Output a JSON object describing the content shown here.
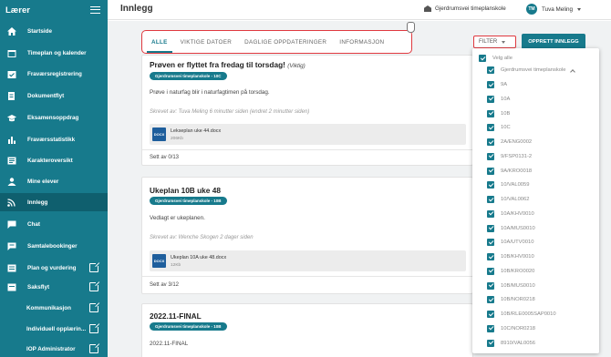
{
  "sidebar": {
    "title": "Lærer",
    "items": [
      {
        "label": "Startside",
        "icon": "home-icon"
      },
      {
        "label": "Timeplan og kalender",
        "icon": "calendar-icon"
      },
      {
        "label": "Fraværsregistrering",
        "icon": "calendar-check-icon"
      },
      {
        "label": "Dokumentflyt",
        "icon": "document-icon"
      },
      {
        "label": "Eksamensoppdrag",
        "icon": "graduation-cap-icon"
      },
      {
        "label": "Fraværsstatistikk",
        "icon": "bar-chart-icon"
      },
      {
        "label": "Karakteroversikt",
        "icon": "grades-icon"
      },
      {
        "label": "Mine elever",
        "icon": "students-icon"
      },
      {
        "label": "Innlegg",
        "icon": "rss-icon"
      },
      {
        "label": "Chat",
        "icon": "chat-icon"
      },
      {
        "label": "Samtalebookinger",
        "icon": "booking-icon"
      },
      {
        "label": "Plan og vurdering",
        "icon": "plan-icon"
      },
      {
        "label": "Saksflyt",
        "icon": "case-icon"
      },
      {
        "label": "Kommunikasjon",
        "icon": ""
      },
      {
        "label": "Individuell opplærin...",
        "icon": ""
      },
      {
        "label": "IOP Administrator",
        "icon": ""
      }
    ]
  },
  "header": {
    "title": "Innlegg",
    "school": "Gjerdrumsvei timeplanskole",
    "user_initials": "TM",
    "user_name": "Tuva Meling"
  },
  "tabs": [
    "ALLE",
    "VIKTIGE DATOER",
    "DAGLIGE OPPDATERINGER",
    "INFORMASJON"
  ],
  "toolbar": {
    "filter_label": "FILTER",
    "create_label": "OPPRETT INNLEGG"
  },
  "posts": [
    {
      "title": "Prøven er flyttet fra fredag til torsdag!",
      "tag": "(Viktig)",
      "badge": "Gjerdrumsvei timeplanskole - 10C",
      "body": "Prøve i naturfag blir i naturfagtimen på torsdag.",
      "meta": "Skrevet av: Tuva Meling 6 minutter siden (endret 2 minutter siden)",
      "file_type": "DOCX",
      "file_name": "Lekseplan uke 44.docx",
      "file_size": "206Kb",
      "seen": "Sett av 0/13"
    },
    {
      "title": "Ukeplan 10B uke 48",
      "badge": "Gjerdrumsvei timeplanskole - 10B",
      "body": "Vedlagt er ukeplanen.",
      "meta": "Skrevet av: Wenche Skogen 2 dager siden",
      "file_type": "DOCX",
      "file_name": "Ukeplan 10A uke 48.docx",
      "file_size": "12Kb",
      "seen": "Sett av 3/12"
    },
    {
      "title": "2022.11-FINAL",
      "badge": "Gjerdrumsvei timeplanskole - 10B",
      "body": "2022.11-FINAL"
    }
  ],
  "filter": {
    "select_all": "Velg alle",
    "school": "Gjerdrumsvei timeplanskole",
    "groups": [
      "9A",
      "10A",
      "10B",
      "10C",
      "2A/ENG0002",
      "9/FSP0131-2",
      "9A/KRO0018",
      "10/VAL0059",
      "10/VAL0062",
      "10A/KHV0010",
      "10A/MUS0010",
      "10A/UTV0010",
      "10B/KHV0010",
      "10B/KRO0020",
      "10B/MUS0010",
      "10B/NOR0218",
      "10B/RLE0005SAP0010",
      "10C/NOR0218",
      "8910/VAL0056"
    ]
  }
}
